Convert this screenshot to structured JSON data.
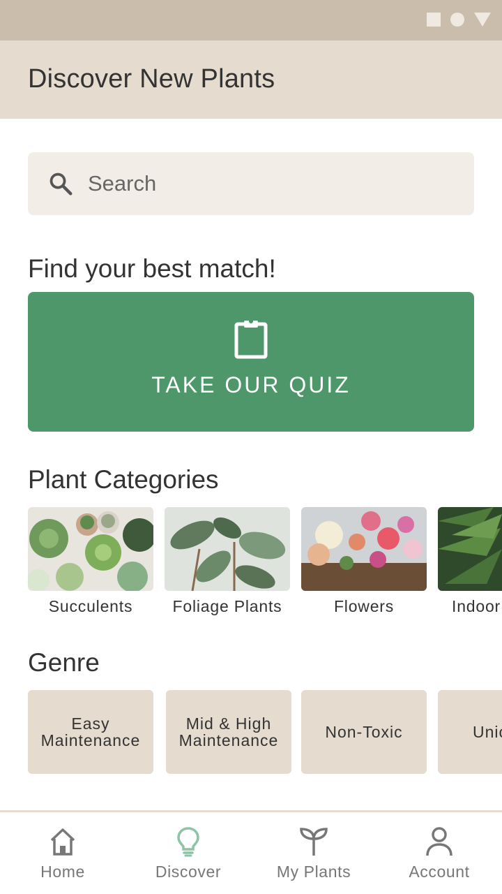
{
  "app": {
    "title": "Discover New Plants"
  },
  "search": {
    "placeholder": "Search"
  },
  "quiz_section": {
    "title": "Find your best match!",
    "button_label": "TAKE OUR QUIZ"
  },
  "categories_section": {
    "title": "Plant Categories",
    "items": [
      {
        "label": "Succulents"
      },
      {
        "label": "Foliage Plants"
      },
      {
        "label": "Flowers"
      },
      {
        "label": "Indoor Pla"
      }
    ]
  },
  "genre_section": {
    "title": "Genre",
    "items": [
      {
        "label": "Easy Maintenance"
      },
      {
        "label": "Mid & High Maintenance"
      },
      {
        "label": "Non-Toxic"
      },
      {
        "label": "Unic"
      }
    ]
  },
  "bottom_nav": {
    "items": [
      {
        "label": "Home",
        "icon": "home-icon"
      },
      {
        "label": "Discover",
        "icon": "lightbulb-icon",
        "active": true
      },
      {
        "label": "My Plants",
        "icon": "sprout-icon"
      },
      {
        "label": "Account",
        "icon": "person-icon"
      }
    ]
  },
  "colors": {
    "status_bar": "#cbbdac",
    "app_bar": "#e5dbcf",
    "accent_green": "#4e976b",
    "active_icon": "#8cc4a4",
    "search_bg": "#f2ede7"
  }
}
